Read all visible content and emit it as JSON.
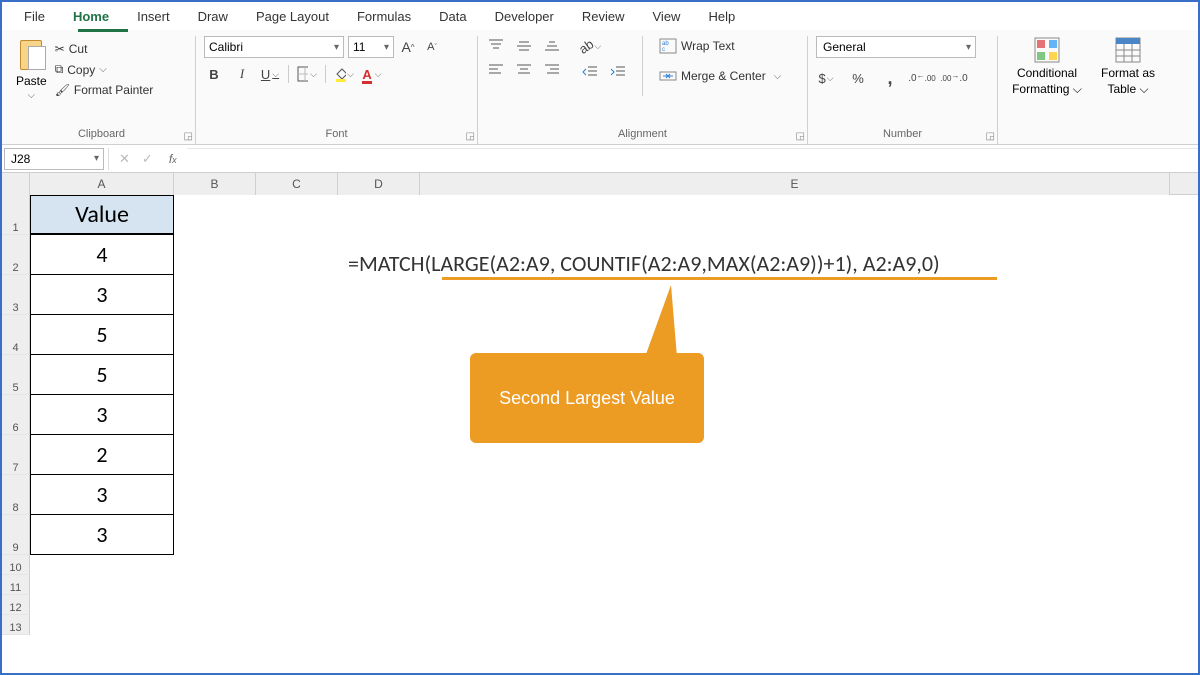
{
  "menu": {
    "items": [
      "File",
      "Home",
      "Insert",
      "Draw",
      "Page Layout",
      "Formulas",
      "Data",
      "Developer",
      "Review",
      "View",
      "Help"
    ],
    "active": "Home"
  },
  "clipboard": {
    "label": "Clipboard",
    "paste": "Paste",
    "cut": "Cut",
    "copy": "Copy",
    "painter": "Format Painter"
  },
  "font": {
    "label": "Font",
    "name": "Calibri",
    "size": "11",
    "bold": "B",
    "italic": "I",
    "underline": "U"
  },
  "alignment": {
    "label": "Alignment",
    "wrap": "Wrap Text",
    "merge": "Merge & Center"
  },
  "number": {
    "label": "Number",
    "format": "General"
  },
  "styles": {
    "cond": "Conditional Formatting",
    "cond2": "",
    "table": "Format as Table",
    "table2": ""
  },
  "stylesLines": {
    "cond_l1": "Conditional",
    "cond_l2": "Formatting ⌵",
    "tbl_l1": "Format as",
    "tbl_l2": "Table ⌵"
  },
  "namebox": "J28",
  "columns": [
    "A",
    "B",
    "C",
    "D",
    "E"
  ],
  "tableHeader": "Value",
  "values": [
    "4",
    "3",
    "5",
    "5",
    "3",
    "2",
    "3",
    "3"
  ],
  "formula": "=MATCH(LARGE(A2:A9, COUNTIF(A2:A9,MAX(A2:A9))+1), A2:A9,0)",
  "callout": "Second Largest Value"
}
